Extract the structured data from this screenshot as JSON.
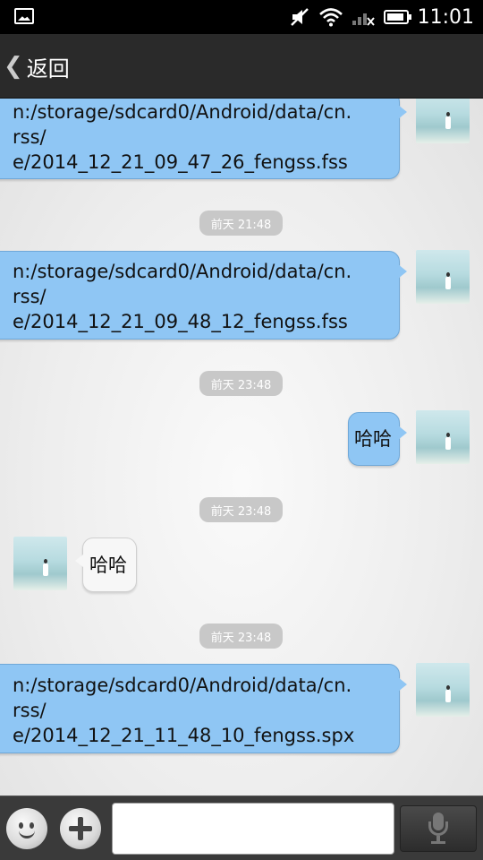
{
  "status_bar": {
    "time": "11:01",
    "icons": [
      "gallery-notification-icon",
      "mute-icon",
      "wifi-icon",
      "signal-icon",
      "battery-icon"
    ]
  },
  "title_bar": {
    "back_label": "返回"
  },
  "messages": [
    {
      "type": "outgoing",
      "text": "n:/storage/sdcard0/Android/data/cn.\nrss/\ne/2014_12_21_09_47_26_fengss.fss"
    },
    {
      "type": "time",
      "text": "前天 21:48"
    },
    {
      "type": "outgoing",
      "text": "n:/storage/sdcard0/Android/data/cn.\nrss/\ne/2014_12_21_09_48_12_fengss.fss"
    },
    {
      "type": "time",
      "text": "前天 23:48"
    },
    {
      "type": "outgoing",
      "text": "哈哈"
    },
    {
      "type": "time",
      "text": "前天 23:48"
    },
    {
      "type": "incoming",
      "text": "哈哈"
    },
    {
      "type": "time",
      "text": "前天 23:48"
    },
    {
      "type": "outgoing",
      "text": "n:/storage/sdcard0/Android/data/cn.\nrss/\ne/2014_12_21_11_48_10_fengss.spx"
    }
  ],
  "input_bar": {
    "value": "",
    "placeholder": ""
  },
  "colors": {
    "outgoing_bubble": "#8fc6f4",
    "incoming_bubble": "#f7f7f7",
    "time_pill": "#c8c8c8",
    "title_bar": "#2a2a2a"
  }
}
